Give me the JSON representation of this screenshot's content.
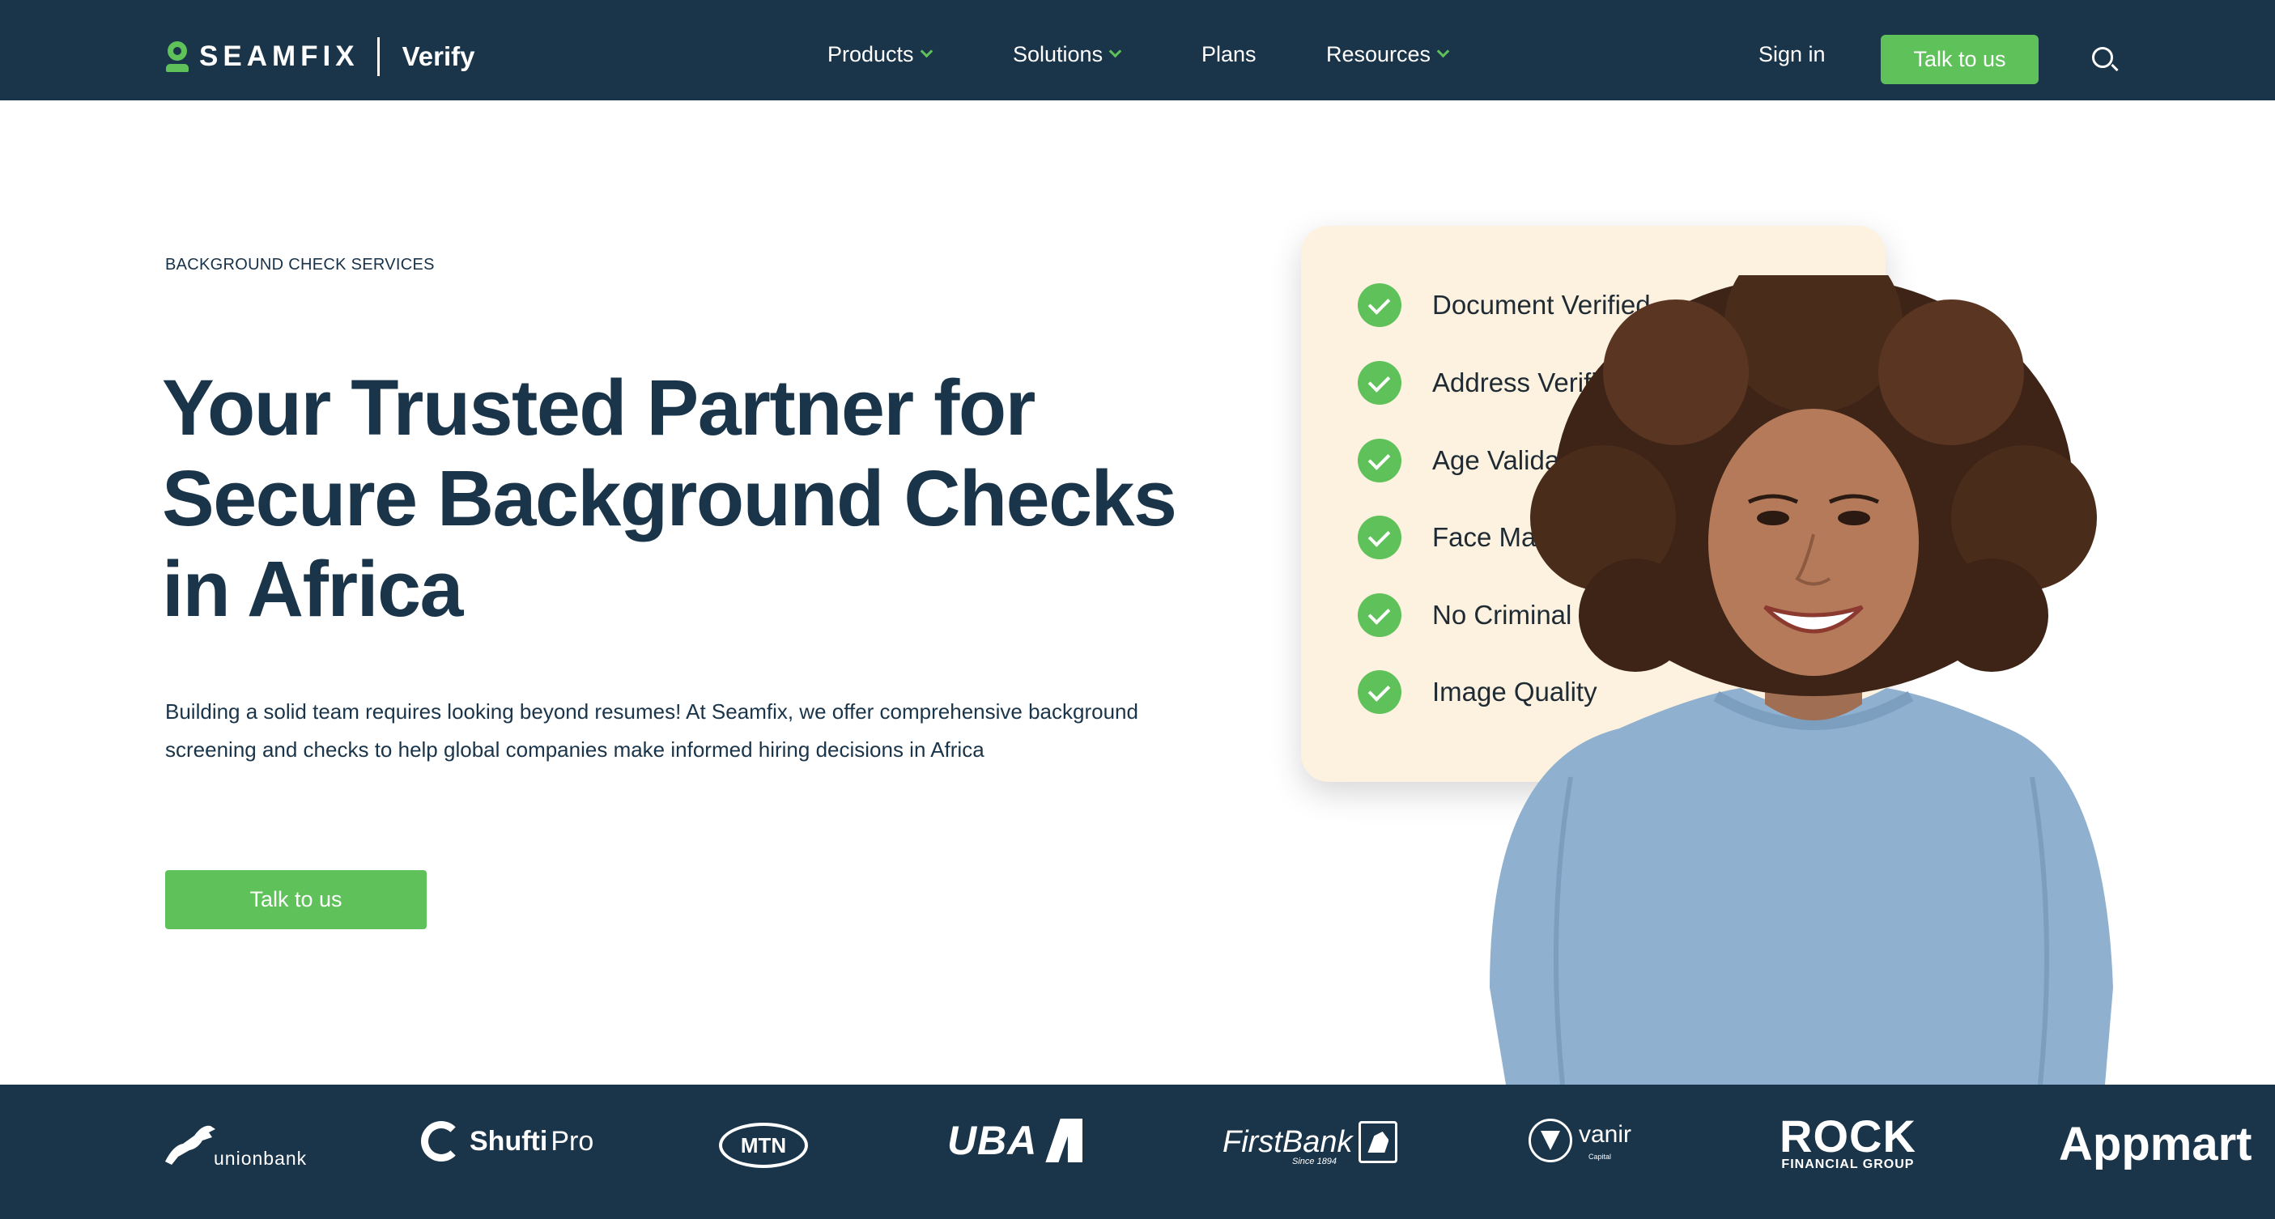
{
  "brand": {
    "name": "SEAMFIX",
    "product": "Verify",
    "accent_color": "#5ec159",
    "navy_color": "#1a3449"
  },
  "nav": {
    "items": [
      {
        "label": "Products",
        "has_dropdown": true
      },
      {
        "label": "Solutions",
        "has_dropdown": true
      },
      {
        "label": "Plans",
        "has_dropdown": false
      },
      {
        "label": "Resources",
        "has_dropdown": true
      }
    ],
    "sign_in": "Sign in",
    "cta": "Talk to us",
    "search_icon": "search-icon"
  },
  "hero": {
    "eyebrow": "BACKGROUND CHECK SERVICES",
    "headline_lines": [
      "Your Trusted Partner for",
      "Secure Background Checks",
      "in Africa"
    ],
    "description": "Building a solid team requires looking beyond resumes! At Seamfix, we offer comprehensive background screening and checks to help global companies make informed hiring decisions in Africa",
    "cta": "Talk to us"
  },
  "checklist": [
    {
      "label": "Document Verified",
      "icon": "check-circle-icon"
    },
    {
      "label": "Address Verified",
      "icon": "check-circle-icon"
    },
    {
      "label": "Age Validated",
      "icon": "check-circle-icon"
    },
    {
      "label": "Face Match",
      "icon": "check-circle-icon"
    },
    {
      "label": "No Criminal",
      "icon": "check-circle-icon"
    },
    {
      "label": "Image Quality",
      "icon": "check-circle-icon"
    }
  ],
  "partners": {
    "union": {
      "name": "unionbank",
      "icon": "horse-icon"
    },
    "shufti": {
      "name": "Shufti",
      "suffix": "Pro"
    },
    "mtn": {
      "name": "MTN"
    },
    "uba": {
      "name": "UBA"
    },
    "firstbank": {
      "name": "FirstBank",
      "tagline": "Since 1894",
      "icon": "elephant-icon"
    },
    "vanir": {
      "name": "vanir",
      "tagline": "Capital"
    },
    "rock": {
      "name": "ROCK",
      "tagline": "FINANCIAL GROUP"
    },
    "appmart": {
      "name": "Appmart"
    }
  }
}
